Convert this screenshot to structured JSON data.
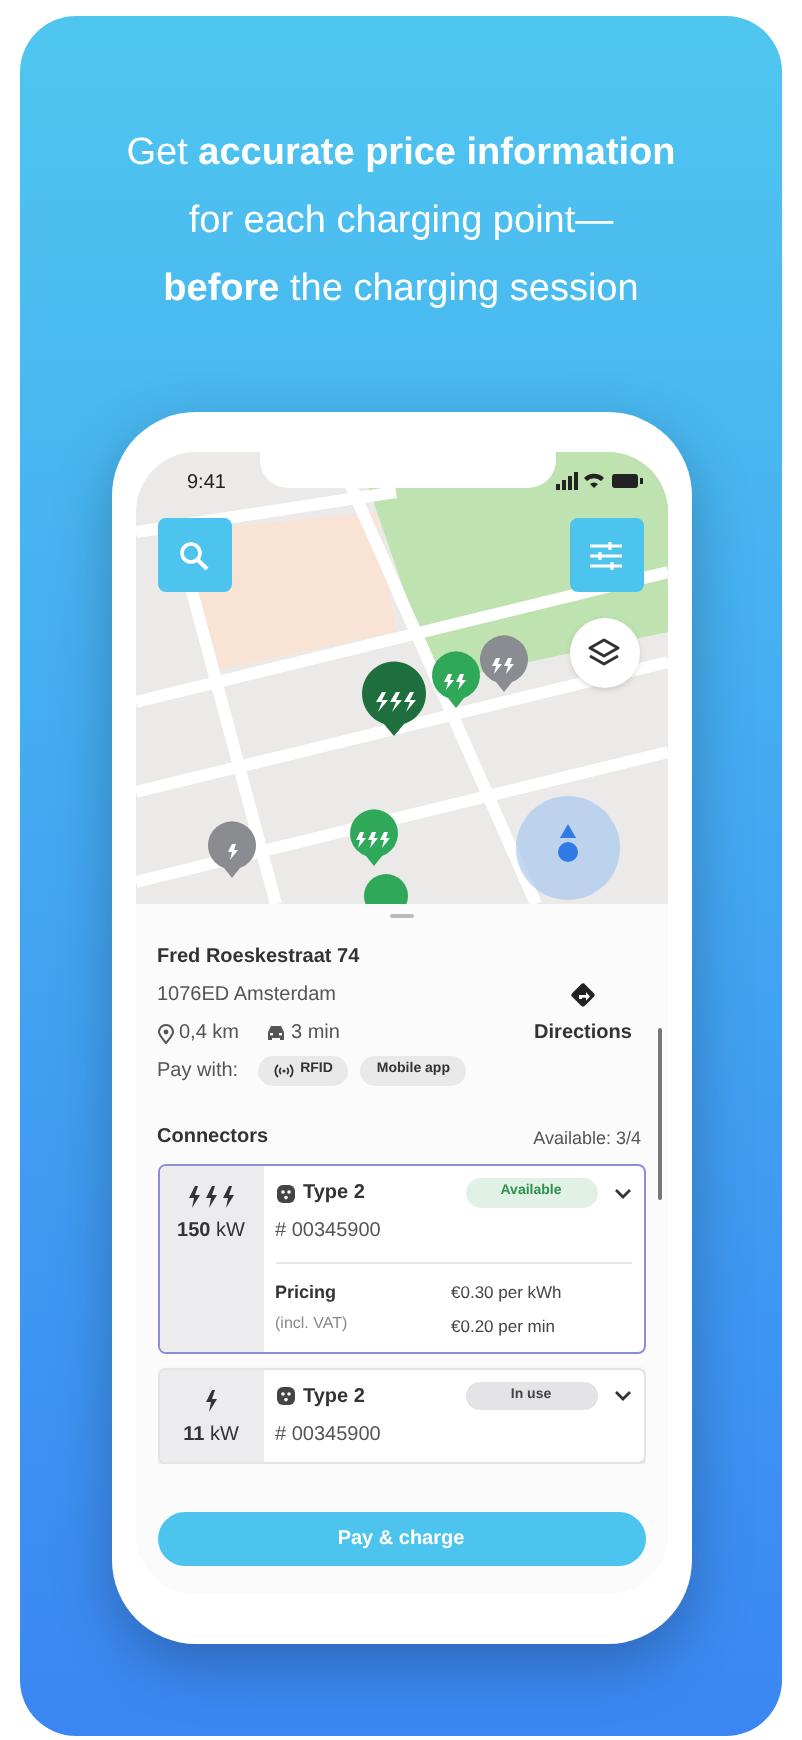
{
  "headline_lines": [
    "Get **accurate price information**",
    "for each charging point—",
    "**before** the charging session"
  ],
  "status_bar": {
    "time": "9:41"
  },
  "location": {
    "name": "Fred Roeskestraat 74",
    "address": "1076ED Amsterdam",
    "distance": "0,4 km",
    "travel_time": "3 min",
    "pay_with_label": "Pay with:",
    "payment_methods": [
      {
        "label": "RFID",
        "kind": "rfid"
      },
      {
        "label": "Mobile app",
        "kind": "app"
      }
    ]
  },
  "directions": {
    "label": "Directions"
  },
  "connectors": {
    "title": "Connectors",
    "availability": "Available: 3/4",
    "items": [
      {
        "kind": "fast",
        "power": "**150** kW",
        "type": "Type 2",
        "id": "# 00345900",
        "status": "Available",
        "available": true,
        "selected": true,
        "pricing": {
          "label": "Pricing",
          "note": "(incl. VAT)",
          "rates": [
            "€0.30 per kWh",
            "€0.20 per min"
          ]
        }
      },
      {
        "kind": "normal",
        "power": "**11** kW",
        "type": "Type 2",
        "id": "# 00345900",
        "status": "In use",
        "available": false,
        "selected": false
      }
    ]
  },
  "primary_button": {
    "label": "Pay & charge"
  }
}
